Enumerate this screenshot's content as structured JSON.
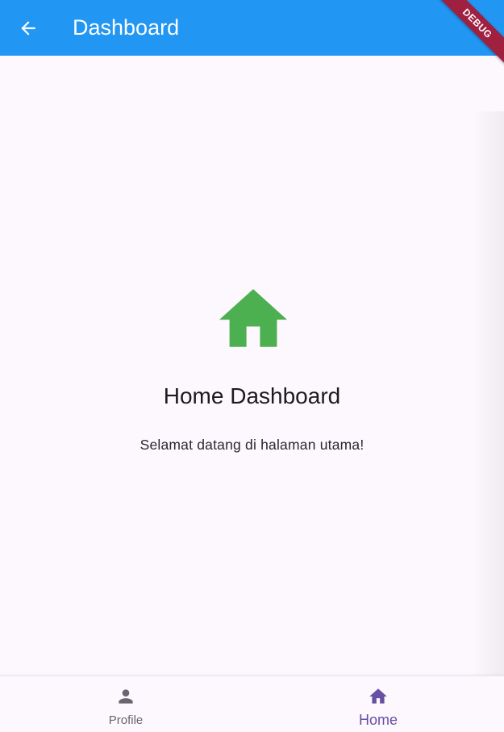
{
  "app_bar": {
    "title": "Dashboard",
    "back_icon": "arrow-back-icon",
    "background": "#2196f3"
  },
  "debug_banner": {
    "label": "DEBUG",
    "color": "#a02040"
  },
  "main": {
    "icon": "home-icon",
    "icon_color": "#4caf50",
    "title": "Home Dashboard",
    "subtitle": "Selamat datang di halaman utama!"
  },
  "bottom_nav": {
    "items": [
      {
        "label": "Profile",
        "icon": "person-icon",
        "selected": false
      },
      {
        "label": "Home",
        "icon": "home-icon",
        "selected": true
      }
    ],
    "selected_color": "#6750a4",
    "unselected_color": "#6a656f"
  }
}
